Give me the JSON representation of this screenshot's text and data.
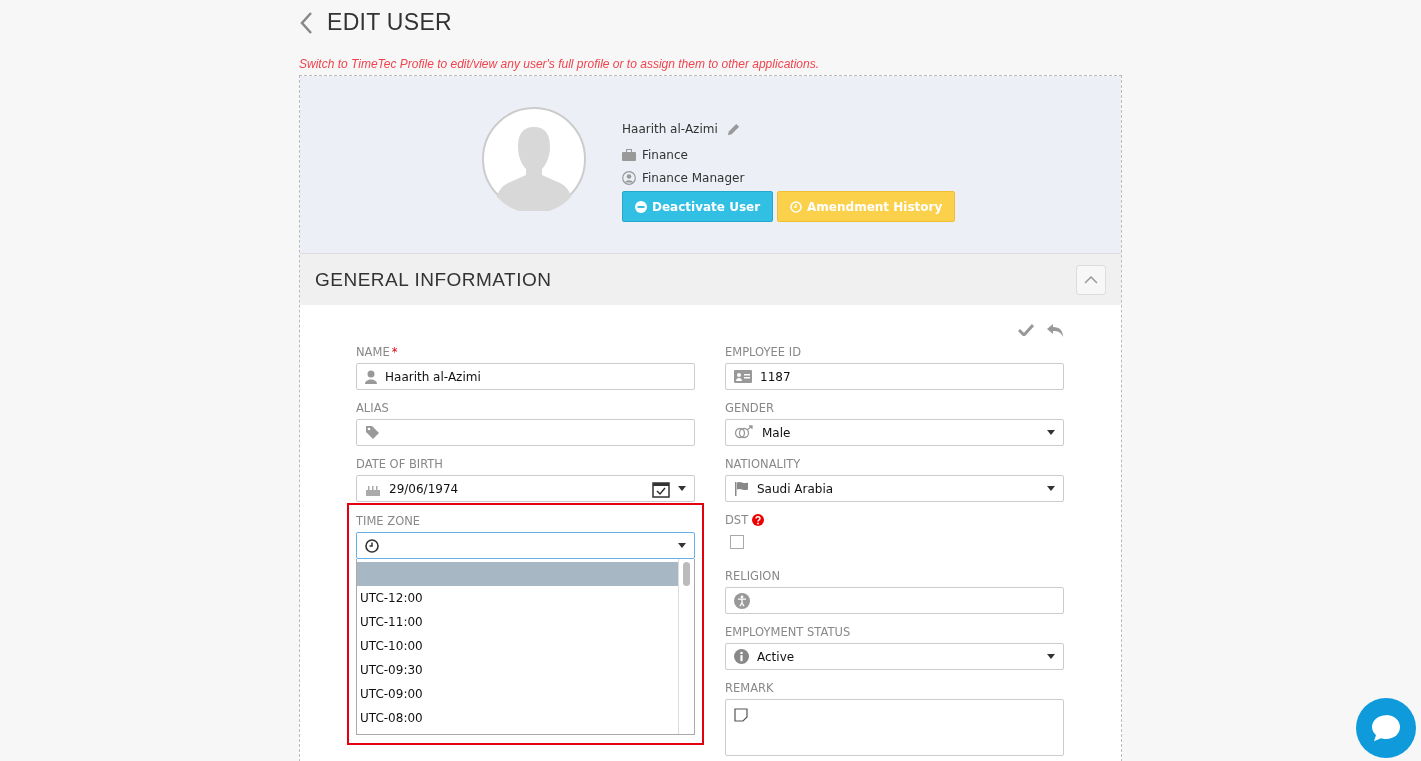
{
  "page": {
    "title": "EDIT USER",
    "notice": "Switch to TimeTec Profile to edit/view any user's full profile or to assign them to other applications."
  },
  "profile": {
    "name": "Haarith al-Azimi",
    "department": "Finance",
    "position": "Finance Manager",
    "buttons": [
      {
        "label": "Deactivate User",
        "kind": "danger"
      },
      {
        "label": "Amendment History",
        "kind": "history"
      }
    ]
  },
  "section": {
    "title": "GENERAL INFORMATION",
    "expanded": true
  },
  "left_fields": [
    {
      "label": "NAME",
      "required_mark": "*",
      "kind": "text",
      "value": "Haarith al-Azimi"
    },
    {
      "label": "ALIAS",
      "kind": "text"
    },
    {
      "label": "DATE OF BIRTH",
      "kind": "date",
      "value": "29/06/1974"
    },
    {
      "label": "TIME ZONE",
      "kind": "dropdown",
      "highlighted": true,
      "blank_option": {
        "selected": true
      },
      "options": [
        {
          "label": "UTC-12:00",
          "selected": false
        },
        {
          "label": "UTC-11:00",
          "selected": false
        },
        {
          "label": "UTC-10:00",
          "selected": false
        },
        {
          "label": "UTC-09:30",
          "selected": false
        },
        {
          "label": "UTC-09:00",
          "selected": false
        },
        {
          "label": "UTC-08:00",
          "selected": false
        }
      ]
    }
  ],
  "right_fields": [
    {
      "label": "EMPLOYEE ID",
      "kind": "text",
      "value": "1187"
    },
    {
      "label": "GENDER",
      "kind": "select",
      "value": "Male"
    },
    {
      "label": "NATIONALITY",
      "kind": "select",
      "value": "Saudi Arabia"
    },
    {
      "label": "DST",
      "kind": "checkbox",
      "help": true,
      "checked": false
    },
    {
      "label": "RELIGION",
      "kind": "text"
    },
    {
      "label": "EMPLOYMENT STATUS",
      "kind": "select",
      "value": "Active"
    },
    {
      "label": "REMARK",
      "kind": "textarea"
    }
  ]
}
